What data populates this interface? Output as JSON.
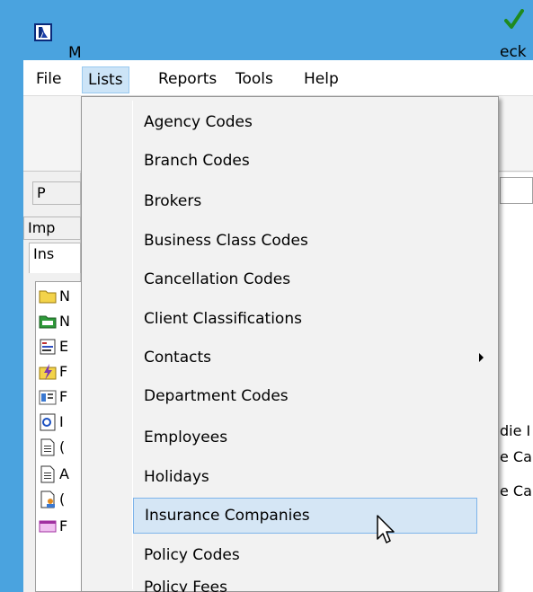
{
  "menubar": {
    "items": [
      "File",
      "Lists",
      "Reports",
      "Tools",
      "Help"
    ]
  },
  "toolbar": {
    "left_partial_label": "M",
    "right_partial_label": "eck"
  },
  "side_tabs": [
    "P",
    "Imp",
    "Ins"
  ],
  "tree_items": [
    "N",
    "N",
    "E",
    "F",
    "F",
    "I",
    "(",
    "A",
    "(",
    "F"
  ],
  "right_peek": [
    "die I",
    "e Ca",
    "e Ca"
  ],
  "lists_menu": {
    "items": [
      {
        "label": "Agency Codes"
      },
      {
        "label": "Branch Codes"
      },
      {
        "label": "Brokers"
      },
      {
        "label": "Business Class Codes"
      },
      {
        "label": "Cancellation Codes"
      },
      {
        "label": "Client Classifications"
      },
      {
        "label": "Contacts",
        "submenu": true
      },
      {
        "label": "Department Codes"
      },
      {
        "label": "Employees"
      },
      {
        "label": "Holidays"
      },
      {
        "label": "Insurance Companies",
        "hovered": true
      },
      {
        "label": "Policy Codes"
      },
      {
        "label": "Policy Fees"
      }
    ]
  },
  "colors": {
    "title_bar": "#4aa3df",
    "menu_hover": "#d5e6f5",
    "menu_hover_border": "#7eb4ea",
    "active_menu": "#cce4f7"
  }
}
